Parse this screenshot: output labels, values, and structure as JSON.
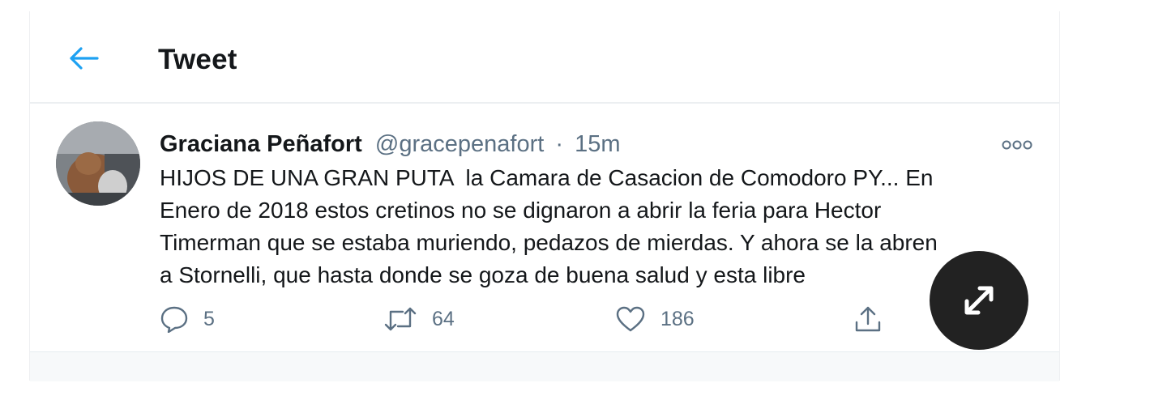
{
  "header": {
    "title": "Tweet",
    "back_icon": "arrow-left-icon",
    "accent_color": "#1da1f2"
  },
  "tweet": {
    "author_name": "Graciana Peñafort",
    "author_handle": "@gracepenafort",
    "separator": "·",
    "time": "15m",
    "text": "HIJOS DE UNA GRAN PUTA  la Camara de Casacion de Comodoro PY... En\nEnero de 2018 estos cretinos no se dignaron a abrir la feria para Hector\nTimerman que se estaba muriendo, pedazos de mierdas. Y ahora se la abren\na Stornelli, que hasta donde se goza de buena salud y esta libre",
    "more_icon": "more-dots-icon"
  },
  "actions": {
    "reply": {
      "icon": "reply-icon",
      "count": "5"
    },
    "retweet": {
      "icon": "retweet-icon",
      "count": "64"
    },
    "like": {
      "icon": "heart-icon",
      "count": "186"
    },
    "share": {
      "icon": "share-icon"
    }
  },
  "overlay": {
    "expand_icon": "expand-arrows-icon"
  }
}
